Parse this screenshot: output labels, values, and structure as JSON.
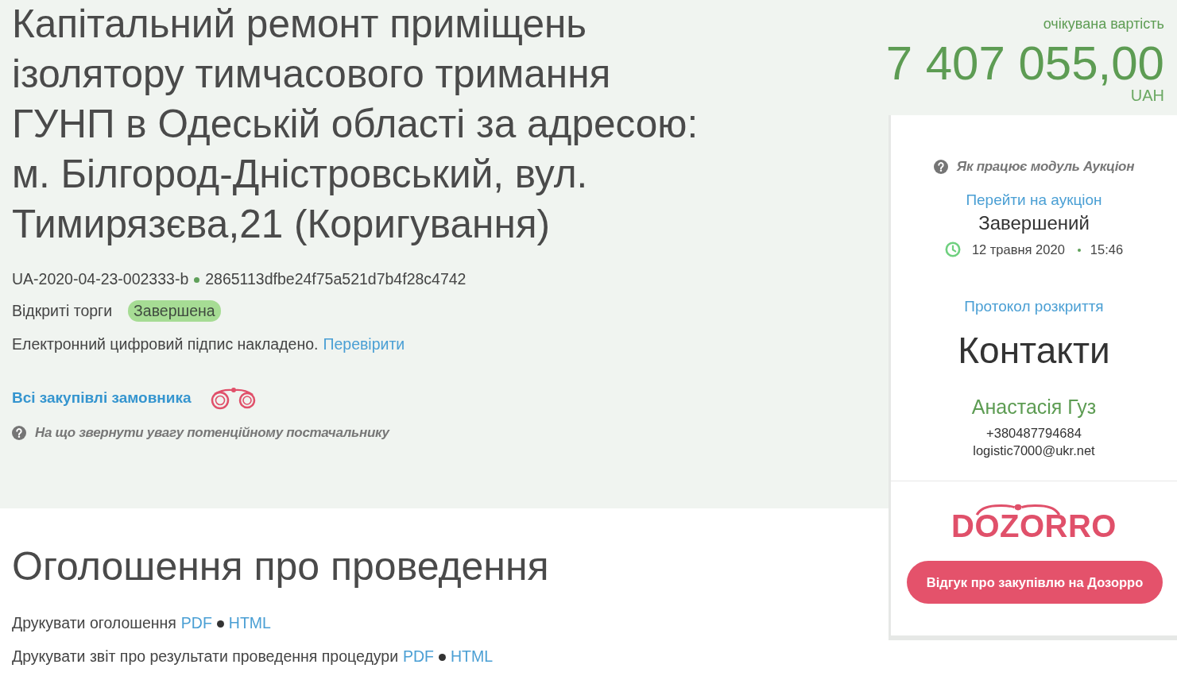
{
  "tender": {
    "title": "Капітальний ремонт приміщень ізолятору тимчасового тримання ГУНП в Одеській області за адресою: м. Білгород-Дністровський, вул. Тимирязєва,21 (Коригування)",
    "tender_id": "UA-2020-04-23-002333-b",
    "hash": "2865113dfbe24f75a521d7b4f28c4742",
    "procedure_type": "Відкриті торги",
    "status_badge": "Завершена",
    "signature": {
      "text": "Електронний цифровий підпис накладено.",
      "link": "Перевірити"
    },
    "customer_link": "Всі закупівлі замовника",
    "supplier_tips_link": "На що звернути увагу потенційному постачальнику"
  },
  "price": {
    "label": "очікувана вартість",
    "amount": "7 407 055,00",
    "currency": "UAH"
  },
  "auction_panel": {
    "help_link": "Як працює модуль Аукціон",
    "auction_link": "Перейти на аукціон",
    "status": "Завершений",
    "date": "12 травня 2020",
    "time": "15:46",
    "protocol_link": "Протокол розкриття"
  },
  "contacts": {
    "title": "Контакти",
    "name": "Анастасія Гуз",
    "phone": "+380487794684",
    "email": "logistic7000@ukr.net"
  },
  "dozorro": {
    "logo": "DOZORRO",
    "button": "Відгук про закупівлю на Дозорро"
  },
  "announcement": {
    "title": "Оголошення про проведення",
    "print_rows": [
      {
        "label": "Друкувати оголошення",
        "links": [
          "PDF",
          "HTML"
        ]
      },
      {
        "label": "Друкувати звіт про результати проведення процедури",
        "links": [
          "PDF",
          "HTML"
        ]
      }
    ]
  }
}
